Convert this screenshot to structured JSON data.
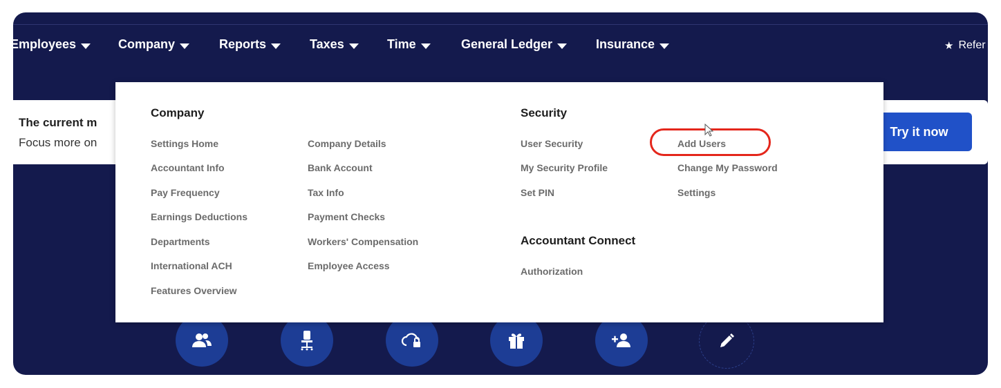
{
  "nav": {
    "items": [
      {
        "label": "Employees"
      },
      {
        "label": "Company"
      },
      {
        "label": "Reports"
      },
      {
        "label": "Taxes"
      },
      {
        "label": "Time"
      },
      {
        "label": "General Ledger"
      },
      {
        "label": "Insurance"
      }
    ],
    "refer_label": "Refer"
  },
  "banner": {
    "title": "The current m",
    "subtitle": "Focus more on",
    "cta_label": "Try it now"
  },
  "dropdown": {
    "company": {
      "title": "Company",
      "col1": [
        "Settings Home",
        "Accountant Info",
        "Pay Frequency",
        "Earnings Deductions",
        "Departments",
        "International ACH",
        "Features Overview"
      ],
      "col2": [
        "Company Details",
        "Bank Account",
        "Tax Info",
        "Payment Checks",
        "Workers' Compensation",
        "Employee Access"
      ]
    },
    "security": {
      "title": "Security",
      "col1": [
        "User Security",
        "My Security Profile",
        "Set PIN"
      ],
      "col2": [
        "Add Users",
        "Change My Password",
        "Settings"
      ]
    },
    "accountant_connect": {
      "title": "Accountant Connect",
      "items": [
        "Authorization"
      ]
    }
  },
  "quick_actions": [
    {
      "icon": "people-icon"
    },
    {
      "icon": "office-chair-icon"
    },
    {
      "icon": "cloud-lock-icon"
    },
    {
      "icon": "gift-icon"
    },
    {
      "icon": "add-person-icon"
    },
    {
      "icon": "pencil-icon"
    }
  ],
  "colors": {
    "background": "#141a4d",
    "accent": "#2051c8",
    "highlight": "#e4261b",
    "circle": "#1d3d95"
  }
}
